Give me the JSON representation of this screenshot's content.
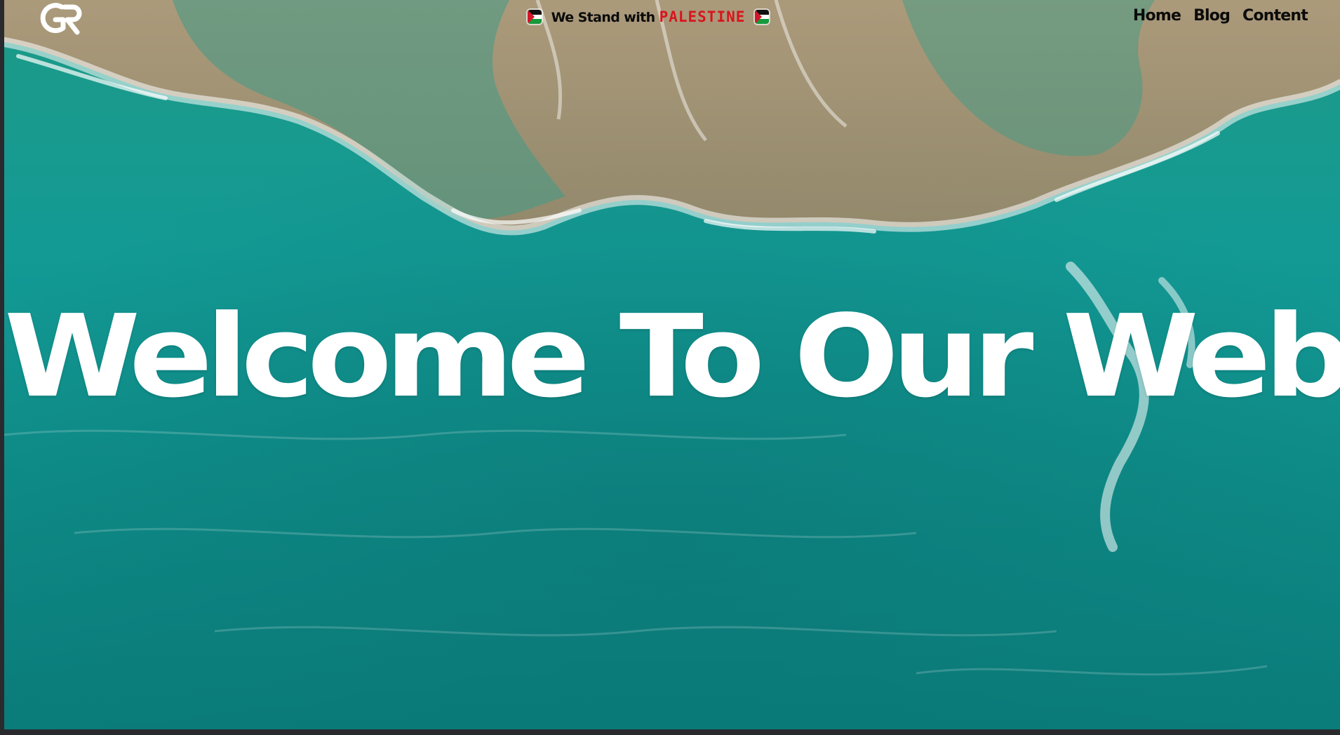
{
  "header": {
    "logo": {
      "icon": "gr-logo-icon",
      "color": "#ffffff"
    },
    "banner": {
      "text": "We Stand with",
      "highlight": "PALESTINE",
      "highlight_color": "#d9141c",
      "flag_icon": "palestine-flag-icon"
    },
    "nav": [
      {
        "label": "Home"
      },
      {
        "label": "Blog"
      },
      {
        "label": "Content"
      }
    ]
  },
  "hero": {
    "title": "Welcome To Our WebSite",
    "background": "aerial-ocean-shoreline"
  },
  "colors": {
    "ocean": "#0f8f8a",
    "sand": "#b88c67",
    "text": "#0b0b0b"
  }
}
